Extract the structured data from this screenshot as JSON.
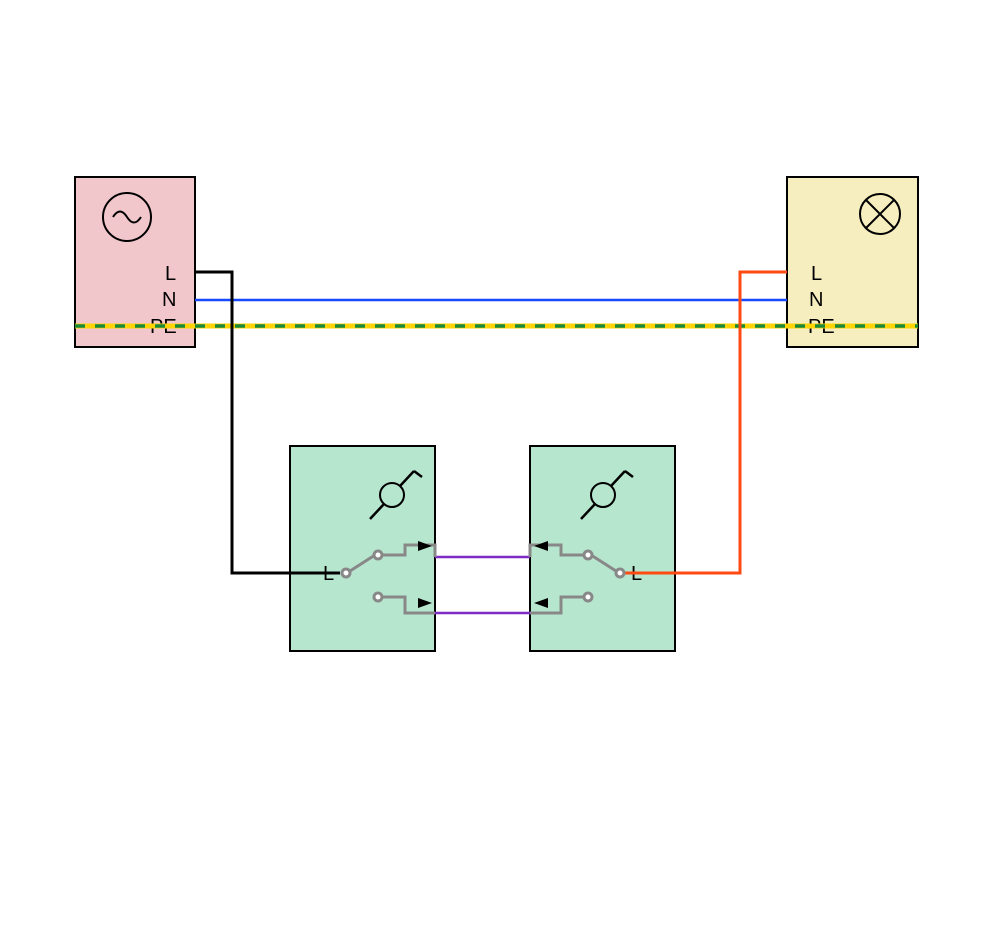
{
  "diagram": {
    "type": "electrical-wiring-schematic",
    "description": "Two-way (alternative) lighting circuit with power source, two changeover switches, and lamp",
    "components": {
      "source": {
        "kind": "AC power supply",
        "symbol": "sine-in-circle",
        "color": "#f2c7cc",
        "terminals": [
          "L",
          "N",
          "PE"
        ]
      },
      "lamp": {
        "kind": "luminaire",
        "symbol": "lamp-X-in-circle",
        "color": "#f7eebf",
        "terminals": [
          "L",
          "N",
          "PE"
        ]
      },
      "switch_left": {
        "kind": "two-way changeover switch",
        "symbol": "single-pole-switch",
        "color": "#b7e6cf",
        "terminals": [
          "L"
        ]
      },
      "switch_right": {
        "kind": "two-way changeover switch",
        "symbol": "single-pole-switch",
        "color": "#b7e6cf",
        "terminals": [
          "L"
        ]
      }
    },
    "conductors": {
      "N": {
        "from": "source.N",
        "to": "lamp.N",
        "color": "#1749ff"
      },
      "PE": {
        "from": "source.PE",
        "to": "lamp.PE",
        "color_base": "#ffd400",
        "color_dash": "#1a8a3a"
      },
      "L_in": {
        "from": "source.L",
        "to": "switch_left.L",
        "color": "#000000"
      },
      "L_out": {
        "from": "switch_right.L",
        "to": "lamp.L",
        "color": "#ff4a12"
      },
      "traveller_top": {
        "from": "switch_left.t1",
        "to": "switch_right.t1",
        "color": "#7d2cc5"
      },
      "traveller_bottom": {
        "from": "switch_left.t2",
        "to": "switch_right.t2",
        "color": "#7d2cc5"
      }
    },
    "labels": {
      "L": "L",
      "N": "N",
      "PE": "PE"
    }
  }
}
